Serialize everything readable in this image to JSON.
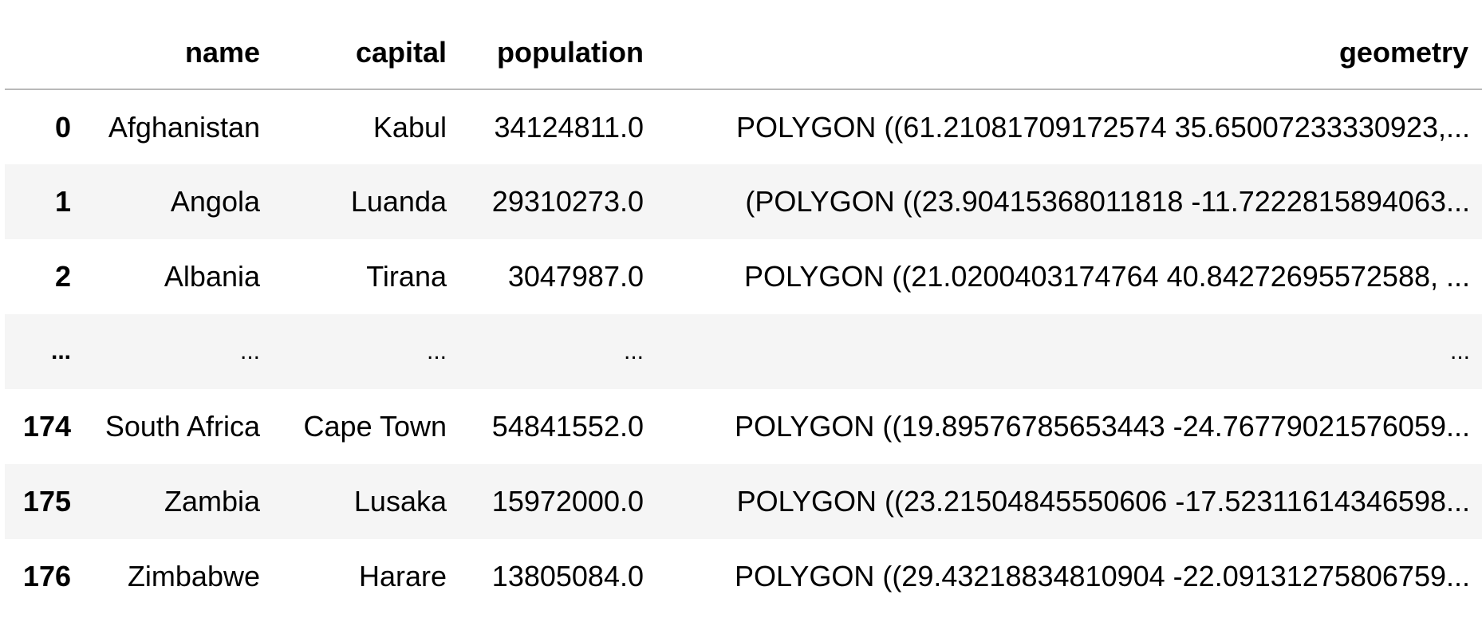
{
  "table": {
    "index_header": "",
    "columns": [
      "name",
      "capital",
      "population",
      "geometry"
    ],
    "rows": [
      {
        "index": "0",
        "name": "Afghanistan",
        "capital": "Kabul",
        "population": "34124811.0",
        "geometry": "POLYGON ((61.21081709172574 35.65007233330923,..."
      },
      {
        "index": "1",
        "name": "Angola",
        "capital": "Luanda",
        "population": "29310273.0",
        "geometry": "(POLYGON ((23.90415368011818 -11.7222815894063..."
      },
      {
        "index": "2",
        "name": "Albania",
        "capital": "Tirana",
        "population": "3047987.0",
        "geometry": "POLYGON ((21.0200403174764 40.84272695572588, ..."
      },
      {
        "index": "...",
        "name": "...",
        "capital": "...",
        "population": "...",
        "geometry": "..."
      },
      {
        "index": "174",
        "name": "South Africa",
        "capital": "Cape Town",
        "population": "54841552.0",
        "geometry": "POLYGON ((19.89576785653443 -24.76779021576059..."
      },
      {
        "index": "175",
        "name": "Zambia",
        "capital": "Lusaka",
        "population": "15972000.0",
        "geometry": "POLYGON ((23.21504845550606 -17.52311614346598..."
      },
      {
        "index": "176",
        "name": "Zimbabwe",
        "capital": "Harare",
        "population": "13805084.0",
        "geometry": "POLYGON ((29.43218834810904 -22.09131275806759..."
      }
    ]
  },
  "colors": {
    "header_border": "#b9b9b9",
    "row_stripe": "#f5f5f5",
    "background": "#ffffff",
    "text": "#000000"
  }
}
